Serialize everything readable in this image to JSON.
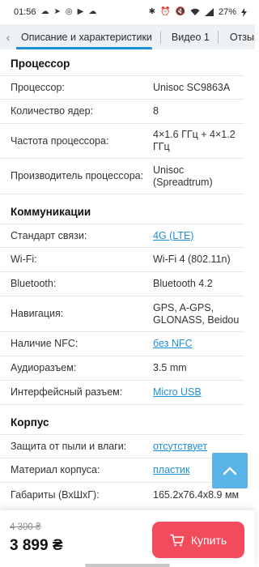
{
  "status_bar": {
    "time": "01:56",
    "battery": "27%"
  },
  "tabs": [
    {
      "label": "Описание и характеристики",
      "active": true
    },
    {
      "label": "Видео 1",
      "active": false
    },
    {
      "label": "Отзывы",
      "active": false
    }
  ],
  "sections": {
    "processor": {
      "title": "Процессор",
      "rows": [
        {
          "label": "Процессор:",
          "value": "Unisoc SC9863A"
        },
        {
          "label": "Количество ядер:",
          "value": "8"
        },
        {
          "label": "Частота процессора:",
          "value": "4×1.6 ГГц + 4×1.2 ГГц"
        },
        {
          "label": "Производитель процессора:",
          "value": "Unisoc (Spreadtrum)"
        }
      ]
    },
    "communications": {
      "title": "Коммуникации",
      "rows": [
        {
          "label": "Стандарт связи:",
          "value": "4G (LTE)"
        },
        {
          "label": "Wi-Fi:",
          "value": "Wi-Fi 4 (802.11n)"
        },
        {
          "label": "Bluetooth:",
          "value": "Bluetooth 4.2"
        },
        {
          "label": "Навигация:",
          "value": "GPS, A-GPS, GLONASS, Beidou"
        },
        {
          "label": "Наличие NFC:",
          "value": "без NFC"
        },
        {
          "label": "Аудиоразъем:",
          "value": "3.5 mm"
        },
        {
          "label": "Интерфейсный разъем:",
          "value": "Micro USB"
        }
      ]
    },
    "body": {
      "title": "Корпус",
      "rows": [
        {
          "label": "Защита от пыли и влаги:",
          "value": "отсутствует"
        },
        {
          "label": "Материал корпуса:",
          "value": "пластик"
        },
        {
          "label": "Габариты (ВхШхГ):",
          "value": "165.2x76.4x8.9 мм"
        }
      ]
    }
  },
  "purchase": {
    "old_price": "4 300 ₴",
    "price": "3 899 ₴",
    "buy_label": "Купить"
  },
  "colors": {
    "accent": "#1f8fd8",
    "buy": "#f24b5c",
    "scroll_up": "#5ab4e8"
  }
}
